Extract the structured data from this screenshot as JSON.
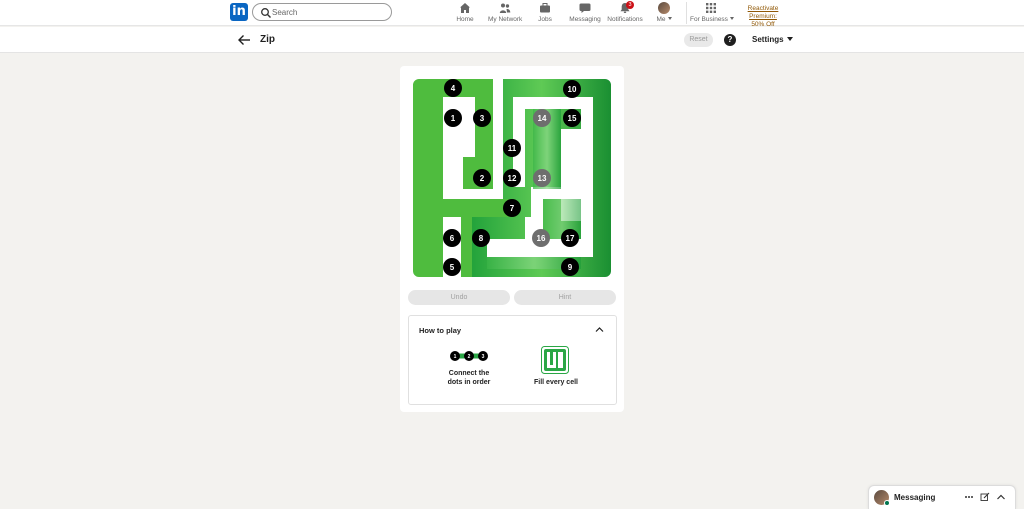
{
  "nav": {
    "logo_text": "in",
    "search_placeholder": "Search",
    "items": [
      {
        "label": "Home",
        "icon": "home-icon"
      },
      {
        "label": "My Network",
        "icon": "network-icon"
      },
      {
        "label": "Jobs",
        "icon": "briefcase-icon"
      },
      {
        "label": "Messaging",
        "icon": "chat-icon"
      },
      {
        "label": "Notifications",
        "icon": "bell-icon",
        "badge": "3"
      },
      {
        "label": "Me",
        "icon": "avatar"
      },
      {
        "label": "For Business",
        "icon": "grid-icon"
      }
    ],
    "premium_line1": "Reactivate Premium:",
    "premium_line2": "50% Off"
  },
  "header": {
    "title": "Zip",
    "reset_label": "Reset",
    "help_label": "?",
    "settings_label": "Settings"
  },
  "game": {
    "colors": {
      "light_green": "#5cc13c",
      "dark_green": "#1e9b3a",
      "dot": "#000000",
      "visited_dot": "#6e6e6e"
    },
    "dots": [
      {
        "n": "1",
        "visited": false
      },
      {
        "n": "2",
        "visited": false
      },
      {
        "n": "3",
        "visited": false
      },
      {
        "n": "4",
        "visited": false
      },
      {
        "n": "5",
        "visited": false
      },
      {
        "n": "6",
        "visited": false
      },
      {
        "n": "7",
        "visited": false
      },
      {
        "n": "8",
        "visited": false
      },
      {
        "n": "9",
        "visited": false
      },
      {
        "n": "10",
        "visited": false
      },
      {
        "n": "11",
        "visited": false
      },
      {
        "n": "12",
        "visited": false
      },
      {
        "n": "13",
        "visited": true
      },
      {
        "n": "14",
        "visited": true
      },
      {
        "n": "15",
        "visited": false
      },
      {
        "n": "16",
        "visited": true
      },
      {
        "n": "17",
        "visited": false
      }
    ],
    "undo_label": "Undo",
    "hint_label": "Hint"
  },
  "howto": {
    "title": "How to play",
    "demo_dots": [
      "1",
      "2",
      "3"
    ],
    "step1_line1": "Connect the",
    "step1_line2": "dots in order",
    "step2_label": "Fill every cell"
  },
  "messaging": {
    "title": "Messaging"
  }
}
